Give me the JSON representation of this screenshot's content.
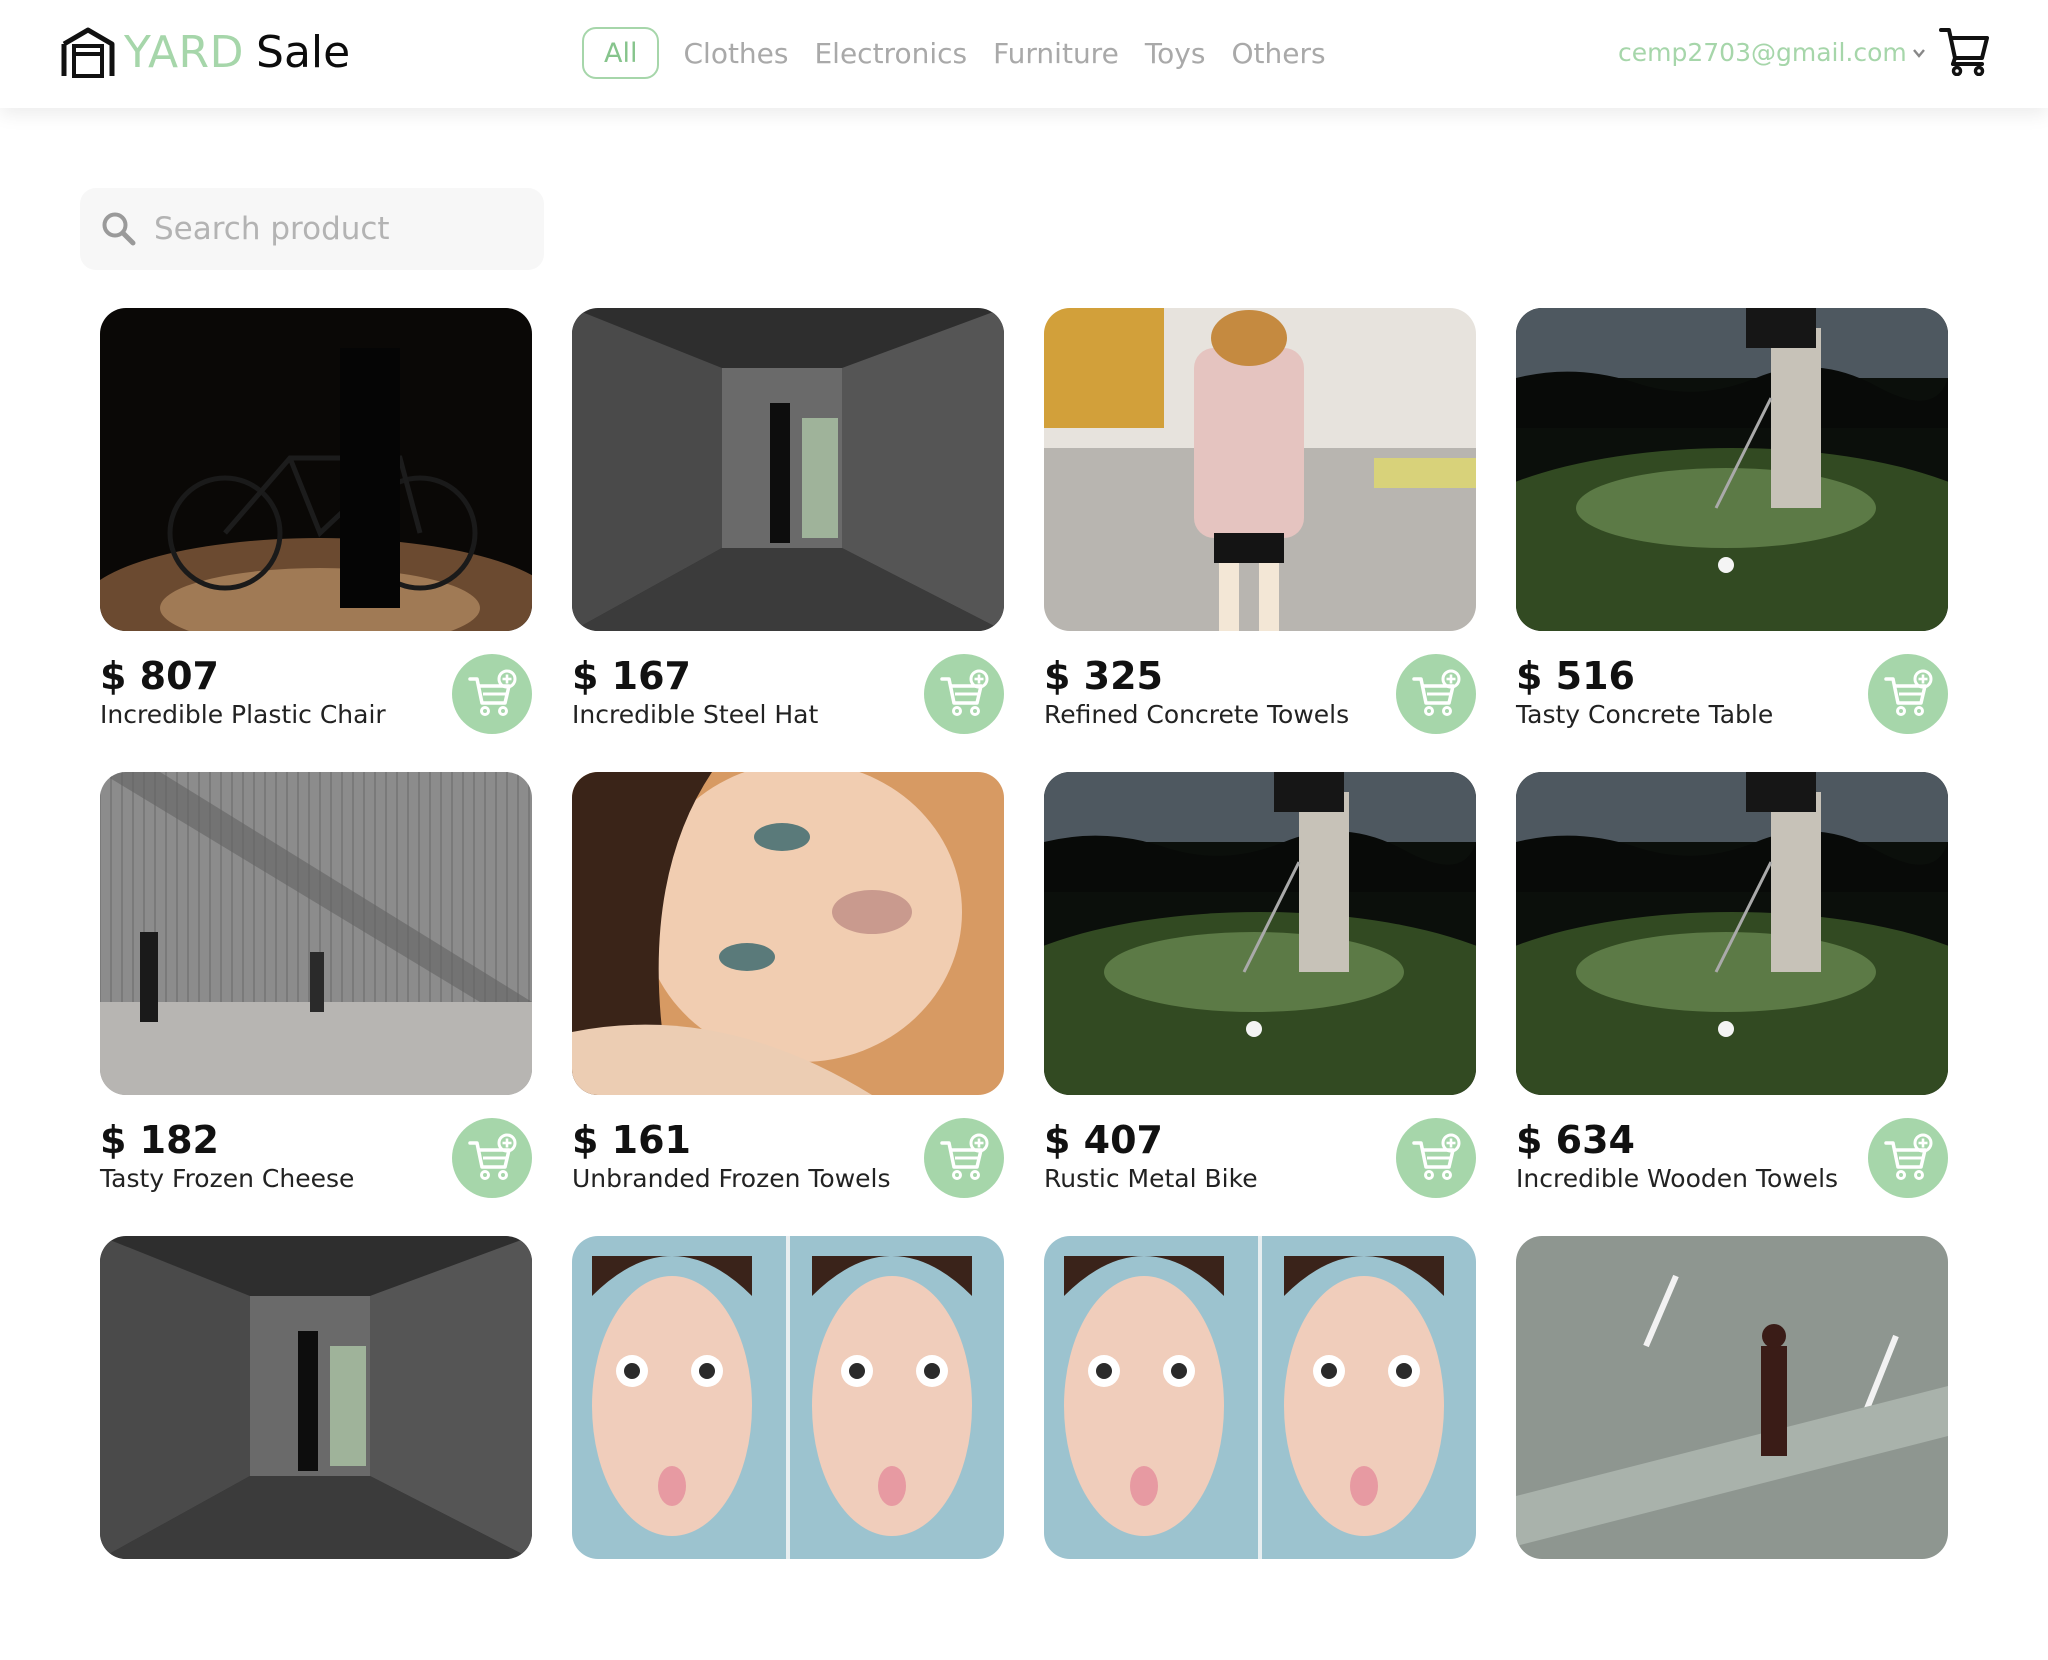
{
  "header": {
    "logo_word1": "YARD",
    "logo_word2": "Sale",
    "nav": [
      "All",
      "Clothes",
      "Electronics",
      "Furniture",
      "Toys",
      "Others"
    ],
    "active_nav": "All",
    "user_email": "cemp2703@gmail.com",
    "cart_icon": "cart-icon"
  },
  "search": {
    "placeholder": "Search product",
    "value": ""
  },
  "colors": {
    "accent": "#a6d6aa",
    "text": "#111111",
    "muted": "#a9a9a9"
  },
  "products": [
    {
      "price": "$ 807",
      "name": "Incredible Plastic Chair",
      "image": "bicycle-silhouette"
    },
    {
      "price": "$ 167",
      "name": "Incredible Steel Hat",
      "image": "concrete-corridor"
    },
    {
      "price": "$ 325",
      "name": "Refined Concrete Towels",
      "image": "woman-pink-coat"
    },
    {
      "price": "$ 516",
      "name": "Tasty Concrete Table",
      "image": "golf-night"
    },
    {
      "price": "$ 182",
      "name": "Tasty Frozen Cheese",
      "image": "wall-walkers"
    },
    {
      "price": "$ 161",
      "name": "Unbranded Frozen Towels",
      "image": "woman-portrait"
    },
    {
      "price": "$ 407",
      "name": "Rustic Metal Bike",
      "image": "golf-night"
    },
    {
      "price": "$ 634",
      "name": "Incredible Wooden Towels",
      "image": "golf-night"
    },
    {
      "price": "",
      "name": "",
      "image": "concrete-corridor"
    },
    {
      "price": "",
      "name": "",
      "image": "woman-duckface"
    },
    {
      "price": "",
      "name": "",
      "image": "woman-duckface"
    },
    {
      "price": "",
      "name": "",
      "image": "man-crossing"
    }
  ]
}
